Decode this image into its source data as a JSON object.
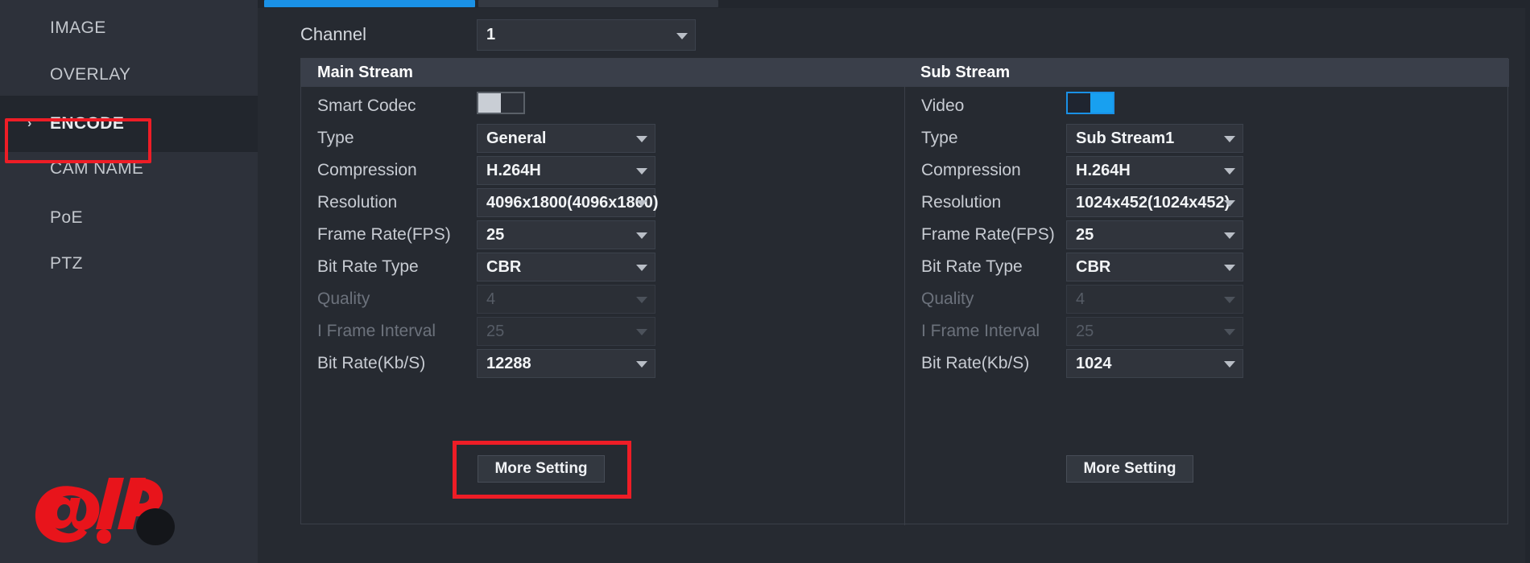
{
  "sidebar": {
    "items": [
      {
        "label": "IMAGE",
        "selected": false,
        "arrow": ""
      },
      {
        "label": "OVERLAY",
        "selected": false,
        "arrow": ""
      },
      {
        "label": "ENCODE",
        "selected": true,
        "arrow": "›"
      },
      {
        "label": "CAM NAME",
        "selected": false,
        "arrow": ""
      },
      {
        "label": "PoE",
        "selected": false,
        "arrow": ""
      },
      {
        "label": "PTZ",
        "selected": false,
        "arrow": ""
      }
    ],
    "logo_text": "@IP"
  },
  "channel": {
    "label": "Channel",
    "value": "1"
  },
  "main_stream": {
    "header": "Main Stream",
    "fields": [
      {
        "label": "Smart Codec",
        "value": "",
        "type": "toggle",
        "on": false,
        "disabled": false
      },
      {
        "label": "Type",
        "value": "General",
        "type": "select",
        "disabled": false
      },
      {
        "label": "Compression",
        "value": "H.264H",
        "type": "select",
        "disabled": false
      },
      {
        "label": "Resolution",
        "value": "4096x1800(4096x1800)",
        "type": "select",
        "disabled": false
      },
      {
        "label": "Frame Rate(FPS)",
        "value": "25",
        "type": "select",
        "disabled": false
      },
      {
        "label": "Bit Rate Type",
        "value": "CBR",
        "type": "select",
        "disabled": false
      },
      {
        "label": "Quality",
        "value": "4",
        "type": "select",
        "disabled": true
      },
      {
        "label": "I Frame Interval",
        "value": "25",
        "type": "select",
        "disabled": true
      },
      {
        "label": "Bit Rate(Kb/S)",
        "value": "12288",
        "type": "select",
        "disabled": false
      }
    ],
    "more_setting": "More Setting"
  },
  "sub_stream": {
    "header": "Sub Stream",
    "fields": [
      {
        "label": "Video",
        "value": "",
        "type": "toggle",
        "on": true,
        "disabled": false
      },
      {
        "label": "Type",
        "value": "Sub Stream1",
        "type": "select",
        "disabled": false
      },
      {
        "label": "Compression",
        "value": "H.264H",
        "type": "select",
        "disabled": false
      },
      {
        "label": "Resolution",
        "value": "1024x452(1024x452)",
        "type": "select",
        "disabled": false
      },
      {
        "label": "Frame Rate(FPS)",
        "value": "25",
        "type": "select",
        "disabled": false
      },
      {
        "label": "Bit Rate Type",
        "value": "CBR",
        "type": "select",
        "disabled": false
      },
      {
        "label": "Quality",
        "value": "4",
        "type": "select",
        "disabled": true
      },
      {
        "label": "I Frame Interval",
        "value": "25",
        "type": "select",
        "disabled": true
      },
      {
        "label": "Bit Rate(Kb/S)",
        "value": "1024",
        "type": "select",
        "disabled": false
      }
    ],
    "more_setting": "More Setting"
  },
  "annotations": {
    "highlight_color": "#ee1d26",
    "accent_color": "#1a91e6"
  }
}
